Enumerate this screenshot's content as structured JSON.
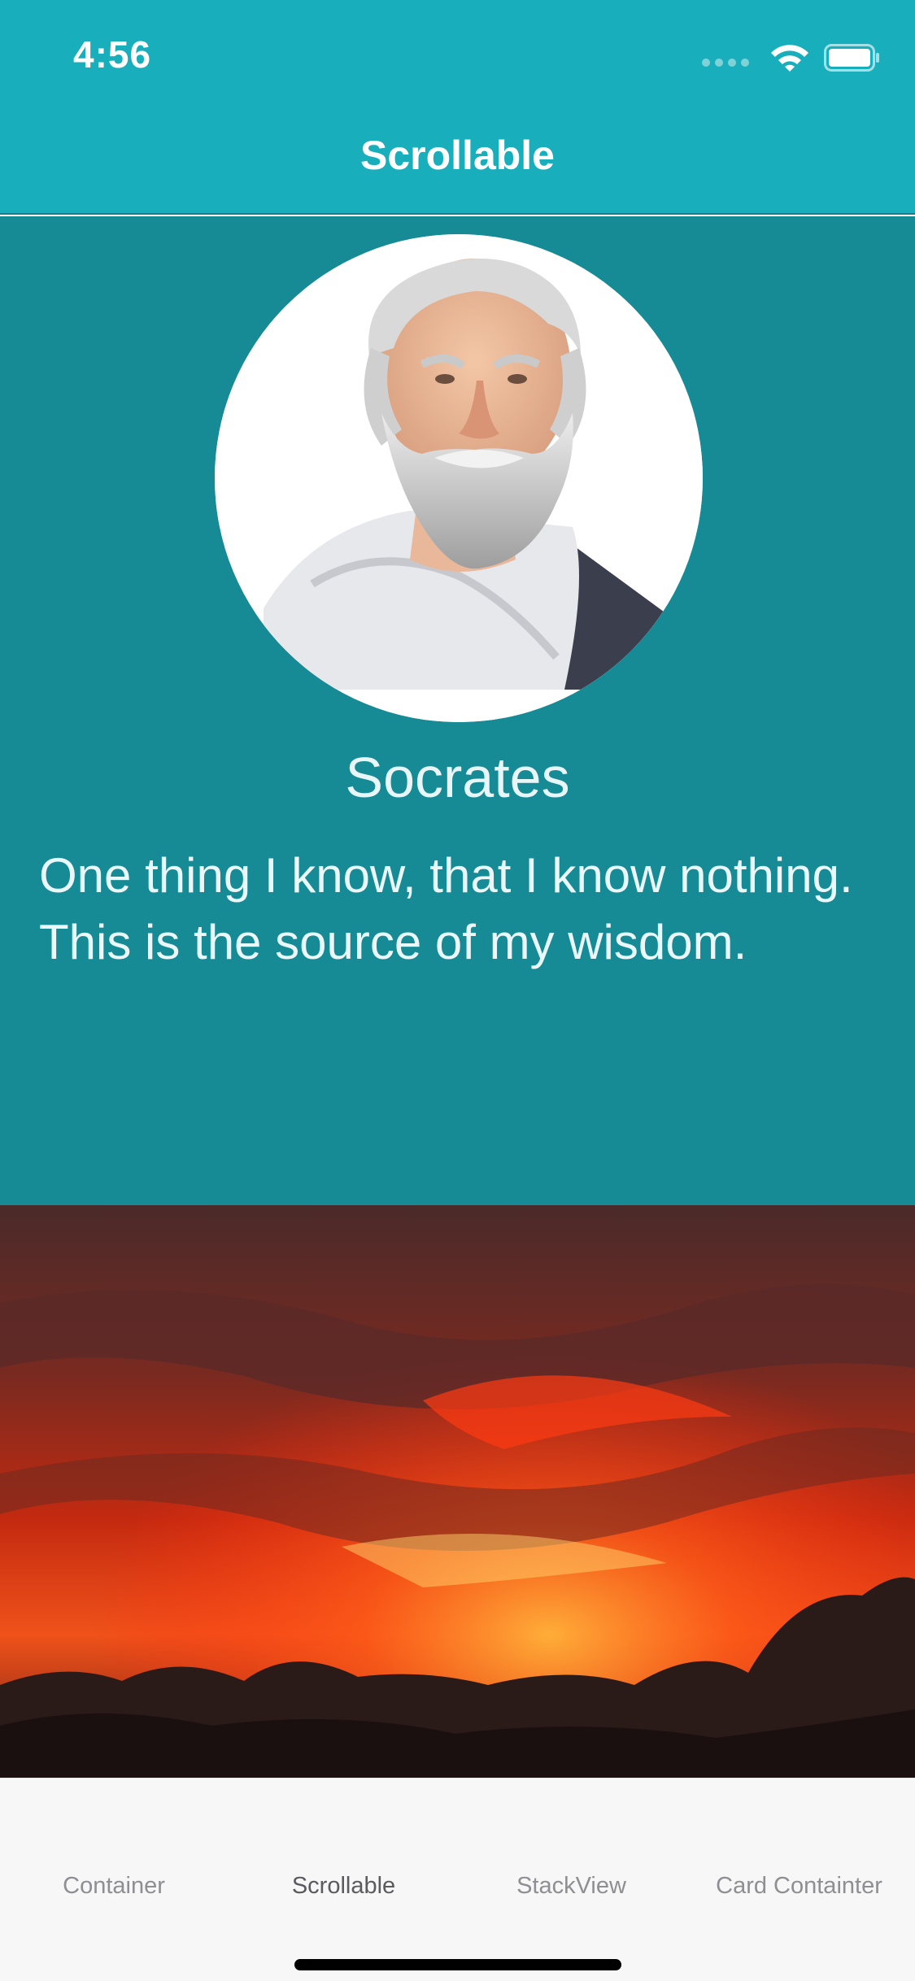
{
  "status_bar": {
    "time": "4:56"
  },
  "nav": {
    "title": "Scrollable"
  },
  "profile": {
    "name": "Socrates",
    "quote": "One thing I know, that I know nothing. This is the source of my wisdom."
  },
  "tabs": [
    {
      "label": "Container",
      "active": false
    },
    {
      "label": "Scrollable",
      "active": true
    },
    {
      "label": "StackView",
      "active": false
    },
    {
      "label": "Card Containter",
      "active": false
    }
  ],
  "colors": {
    "nav_bar": "#19AEBB",
    "profile_bg": "#168B96",
    "tab_bar_bg": "#F7F7F7",
    "tab_inactive": "#8E8E93",
    "tab_active": "#5A5A5F"
  },
  "icons": {
    "status_signal": "cellular-signal-icon",
    "status_wifi": "wifi-icon",
    "status_battery": "battery-icon"
  }
}
